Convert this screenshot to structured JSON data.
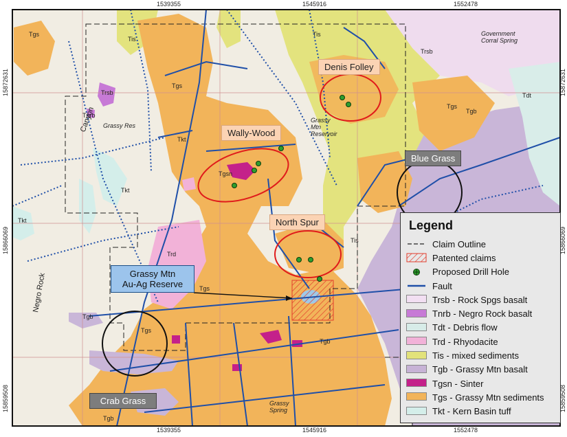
{
  "map": {
    "grid_labels": {
      "top": [
        "1539355",
        "1545916",
        "1552478"
      ],
      "bottom": [
        "1539355",
        "1545916",
        "1552478"
      ],
      "left": [
        "15872631",
        "15866069",
        "15859508"
      ],
      "right": [
        "15872631",
        "15866069",
        "15859508"
      ]
    },
    "prospects": [
      "Denis Folley",
      "Wally-Wood",
      "Blue Grass",
      "North Spur",
      "Crab Grass"
    ],
    "reserve_label": [
      "Grassy Mtn",
      "Au-Ag Reserve"
    ],
    "unit_labels": [
      "Tgs",
      "Tis",
      "Tgb",
      "Trsb",
      "Tdt",
      "Tkt",
      "Trd",
      "Tnrb",
      "Tgsn"
    ],
    "place_labels": [
      "Canyon",
      "Negro Rock",
      "Grassy Mtn Reservoir",
      "Grassy Res",
      "Government Corral Spring",
      "Grassy Spring"
    ]
  },
  "legend": {
    "title": "Legend",
    "items": [
      {
        "label": "Claim Outline",
        "symbol": "claim-outline",
        "color": "#222222"
      },
      {
        "label": "Patented claims",
        "symbol": "patented",
        "color": "#e23b2b"
      },
      {
        "label": "Proposed Drill Hole",
        "symbol": "drill-hole",
        "color": "#2e9e2e"
      },
      {
        "label": "Fault",
        "symbol": "fault",
        "color": "#1f4fa8"
      },
      {
        "label": "Trsb - Rock Spgs basalt",
        "symbol": "swatch",
        "color": "#f2dff2"
      },
      {
        "label": "Tnrb - Negro Rock basalt",
        "symbol": "swatch",
        "color": "#c77ad6"
      },
      {
        "label": "Tdt - Debris flow",
        "symbol": "swatch",
        "color": "#d7ece8"
      },
      {
        "label": "Trd - Rhyodacite",
        "symbol": "swatch",
        "color": "#f2b2d8"
      },
      {
        "label": "Tis - mixed sediments",
        "symbol": "swatch",
        "color": "#e2e27a"
      },
      {
        "label": "Tgb - Grassy Mtn basalt",
        "symbol": "swatch",
        "color": "#c7b3d6"
      },
      {
        "label": "Tgsn - Sinter",
        "symbol": "swatch",
        "color": "#c4218a"
      },
      {
        "label": "Tgs - Grassy Mtn sediments",
        "symbol": "swatch",
        "color": "#f2b45a"
      },
      {
        "label": "Tkt - Kern Basin tuff",
        "symbol": "swatch",
        "color": "#d4eeea"
      }
    ]
  }
}
